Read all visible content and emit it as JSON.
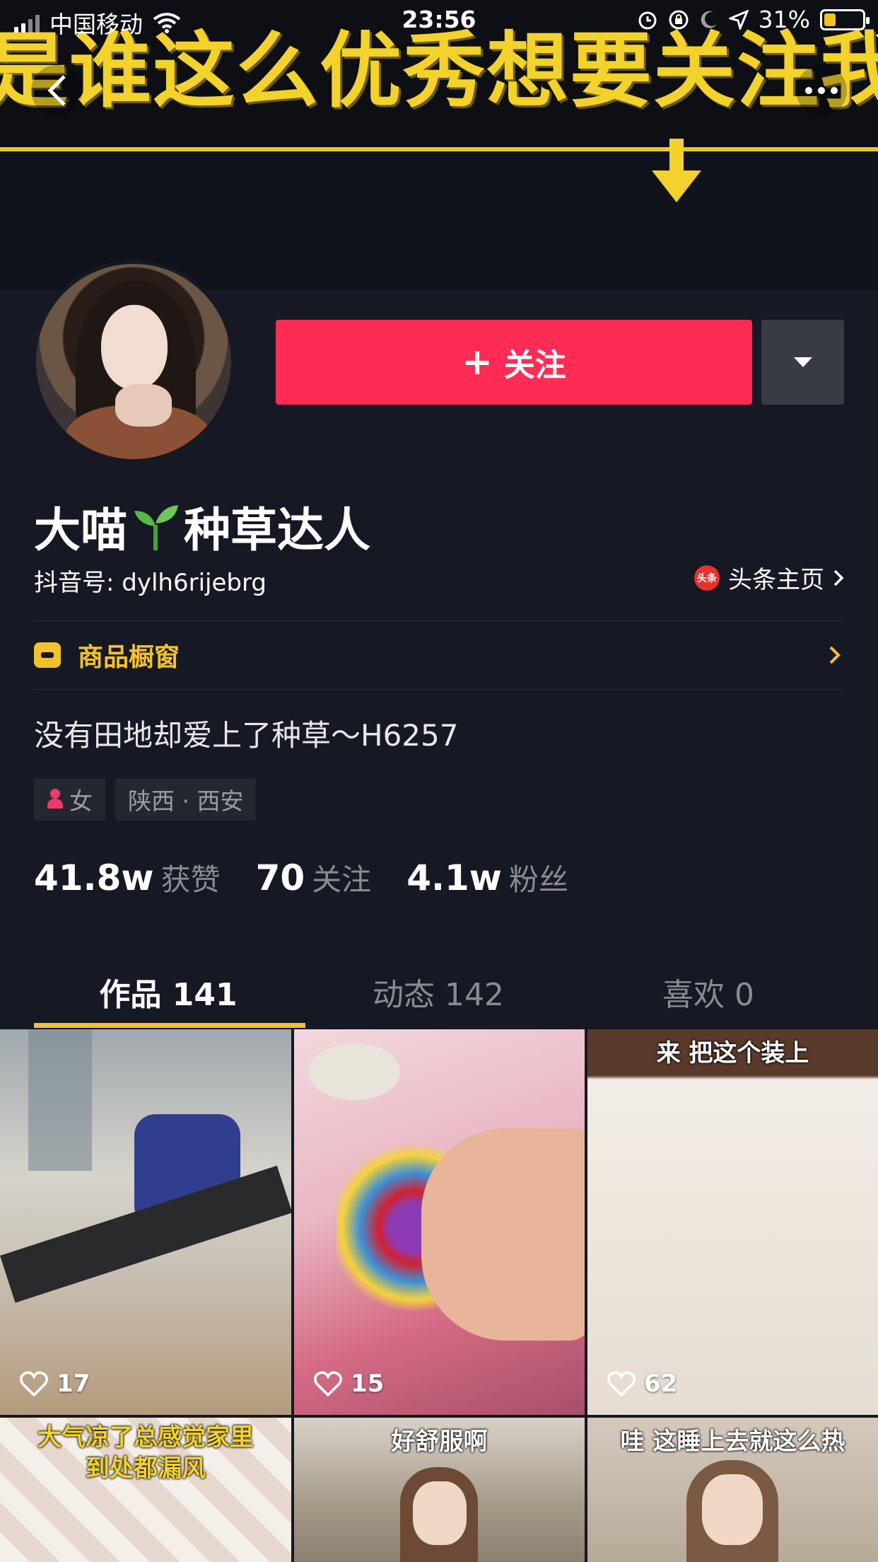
{
  "status_bar": {
    "carrier": "中国移动",
    "time": "23:56",
    "battery_percent": "31%",
    "battery_level": 0.31
  },
  "banner": {
    "text": "是谁这么优秀想要关注我"
  },
  "profile": {
    "follow_label": "关注",
    "nickname_part1": "大喵",
    "nickname_part2": "种草达人",
    "douyin_id": "抖音号: dylh6rijebrg",
    "toutiao_label": "头条主页",
    "toutiao_icon_text": "头条",
    "shop_label": "商品橱窗",
    "bio": "没有田地却爱上了种草～H6257",
    "tags": {
      "gender": "女",
      "location": "陕西 · 西安"
    },
    "stats": [
      {
        "num": "41.8w",
        "label": "获赞"
      },
      {
        "num": "70",
        "label": "关注"
      },
      {
        "num": "4.1w",
        "label": "粉丝"
      }
    ]
  },
  "tabs": [
    {
      "label": "作品 141",
      "active": true
    },
    {
      "label": "动态 142",
      "active": false
    },
    {
      "label": "喜欢 0",
      "active": false
    }
  ],
  "videos": [
    {
      "likes": "17",
      "caption": ""
    },
    {
      "likes": "15",
      "caption": ""
    },
    {
      "likes": "62",
      "caption": "来 把这个装上"
    },
    {
      "likes": "",
      "caption": "大气凉了总感觉家里到处都漏风"
    },
    {
      "likes": "",
      "caption": "好舒服啊"
    },
    {
      "likes": "",
      "caption": "哇 这睡上去就这么热"
    }
  ],
  "colors": {
    "background": "#161823",
    "follow_button": "#fe2c55",
    "accent_yellow": "#f2c12e"
  },
  "icons": [
    "back-icon",
    "more-icon",
    "wifi-icon",
    "alarm-icon",
    "lock-rotation-icon",
    "moon-icon",
    "location-icon",
    "battery-icon",
    "plus-icon",
    "dropdown-triangle-icon",
    "sprout-icon",
    "toutiao-icon",
    "chevron-right-icon",
    "shop-icon",
    "female-icon",
    "heart-icon"
  ]
}
